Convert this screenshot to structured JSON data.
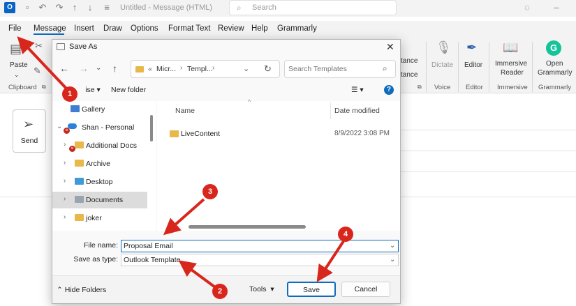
{
  "titlebar": {
    "title": "Untitled  -  Message (HTML)",
    "search_placeholder": "Search"
  },
  "menu": {
    "items": [
      "File",
      "Message",
      "Insert",
      "Draw",
      "Options",
      "Format Text",
      "Review",
      "Help",
      "Grammarly"
    ],
    "active": "Message"
  },
  "ribbon": {
    "paste_label": "Paste",
    "clipboard_label": "Clipboard",
    "tance_top": "tance",
    "tance_bottom": "tance",
    "dictate_label": "Dictate",
    "voice_label": "Voice",
    "editor_label": "Editor",
    "editor_group_label": "Editor",
    "immersive_label_1": "Immersive",
    "immersive_label_2": "Reader",
    "immersive_group_label": "Immersive",
    "grammarly_label_1": "Open",
    "grammarly_label_2": "Grammarly",
    "grammarly_group_label": "Grammarly"
  },
  "compose": {
    "send_label": "Send"
  },
  "dialog": {
    "title": "Save As",
    "breadcrumb": [
      "«",
      "Micr...",
      "Templ...",
      ""
    ],
    "search_placeholder": "Search Templates",
    "organise_label": "Organise",
    "organise_partial": "ise",
    "new_folder_label": "New folder",
    "tree": [
      {
        "label": "Gallery"
      },
      {
        "label": "Shan - Personal"
      },
      {
        "label": "Additional Docs"
      },
      {
        "label": "Archive"
      },
      {
        "label": "Desktop"
      },
      {
        "label": "Documents"
      },
      {
        "label": "joker"
      }
    ],
    "columns": {
      "name": "Name",
      "date": "Date modified"
    },
    "files": [
      {
        "name": "LiveContent",
        "date": "8/9/2022 3:08 PM"
      }
    ],
    "file_name_label": "File name:",
    "file_name_value": "Proposal Email",
    "save_type_label": "Save as type:",
    "save_type_value": "Outlook Template",
    "hide_folders_label": "Hide Folders",
    "tools_label": "Tools",
    "save_button": "Save",
    "cancel_button": "Cancel"
  },
  "annotations": [
    "1",
    "2",
    "3",
    "4"
  ],
  "colors": {
    "accent": "#0f6cbd",
    "annotation": "#d8261c",
    "folder": "#e8b84a"
  }
}
